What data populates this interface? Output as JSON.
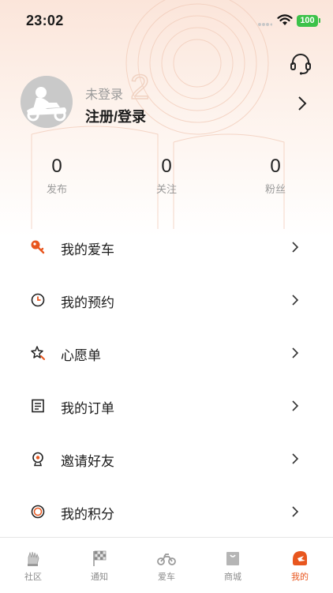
{
  "status_bar": {
    "time": "23:02",
    "battery": "100"
  },
  "colors": {
    "accent": "#e8561e",
    "text": "#1c1c1c",
    "muted": "#9a9a9a",
    "background_tint": "#fbe5da"
  },
  "header": {
    "support_icon": "headset-icon"
  },
  "profile": {
    "login_status": "未登录",
    "login_link": "注册/登录"
  },
  "stats": [
    {
      "value": "0",
      "label": "发布"
    },
    {
      "value": "0",
      "label": "关注"
    },
    {
      "value": "0",
      "label": "粉丝"
    }
  ],
  "menu": [
    {
      "label": "我的爱车",
      "icon": "key-icon"
    },
    {
      "label": "我的预约",
      "icon": "clock-icon"
    },
    {
      "label": "心愿单",
      "icon": "star-icon"
    },
    {
      "label": "我的订单",
      "icon": "order-list-icon"
    },
    {
      "label": "邀请好友",
      "icon": "invite-badge-icon"
    },
    {
      "label": "我的积分",
      "icon": "points-coin-icon"
    }
  ],
  "tabbar": [
    {
      "label": "社区",
      "icon": "glove-icon",
      "active": false
    },
    {
      "label": "通知",
      "icon": "checkered-flag-icon",
      "active": false
    },
    {
      "label": "爱车",
      "icon": "motorcycle-icon",
      "active": false
    },
    {
      "label": "商城",
      "icon": "shopping-bag-icon",
      "active": false
    },
    {
      "label": "我的",
      "icon": "helmet-icon",
      "active": true
    }
  ]
}
